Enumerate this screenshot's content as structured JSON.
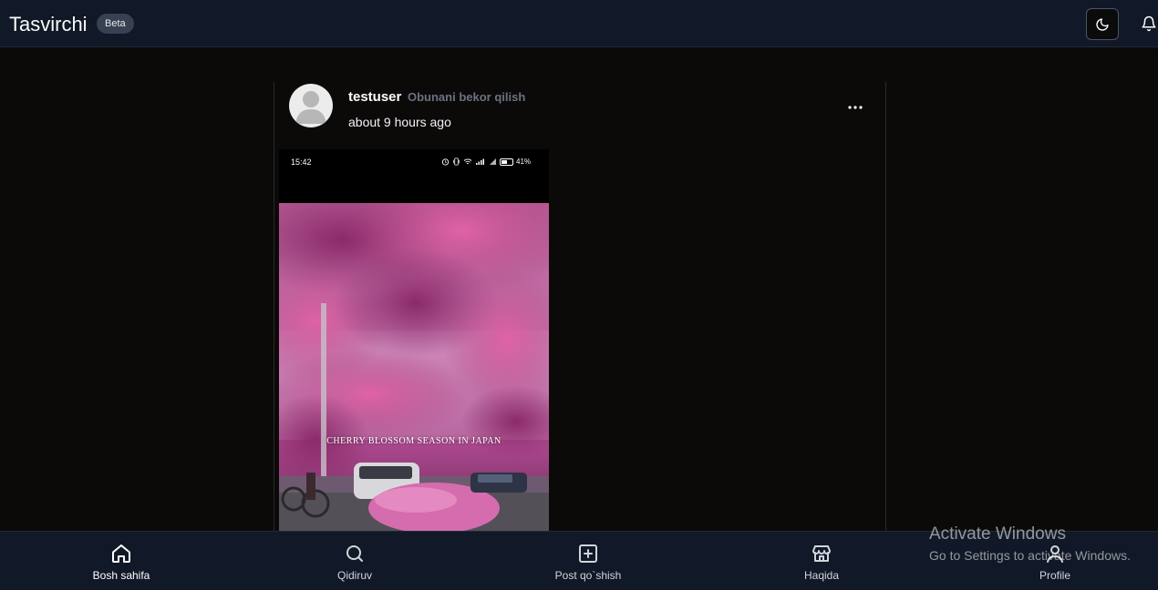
{
  "header": {
    "brand": "Tasvirchi",
    "badge": "Beta"
  },
  "post": {
    "username": "testuser",
    "follow_action": "Obunani bekor qilish",
    "time": "about 9 hours ago",
    "media": {
      "status_time": "15:42",
      "battery": "41%",
      "caption": "CHERRY BLOSSOM SEASON IN JAPAN"
    }
  },
  "nav": {
    "items": [
      {
        "label": "Bosh sahifa",
        "icon": "home-icon"
      },
      {
        "label": "Qidiruv",
        "icon": "search-icon"
      },
      {
        "label": "Post qo`shish",
        "icon": "plus-square-icon"
      },
      {
        "label": "Haqida",
        "icon": "store-icon"
      },
      {
        "label": "Profile",
        "icon": "user-icon"
      }
    ]
  },
  "watermark": {
    "title": "Activate Windows",
    "subtitle": "Go to Settings to activate Windows."
  },
  "colors": {
    "background": "#0c0a09",
    "bar": "#111827",
    "muted_text": "#6b7280"
  }
}
